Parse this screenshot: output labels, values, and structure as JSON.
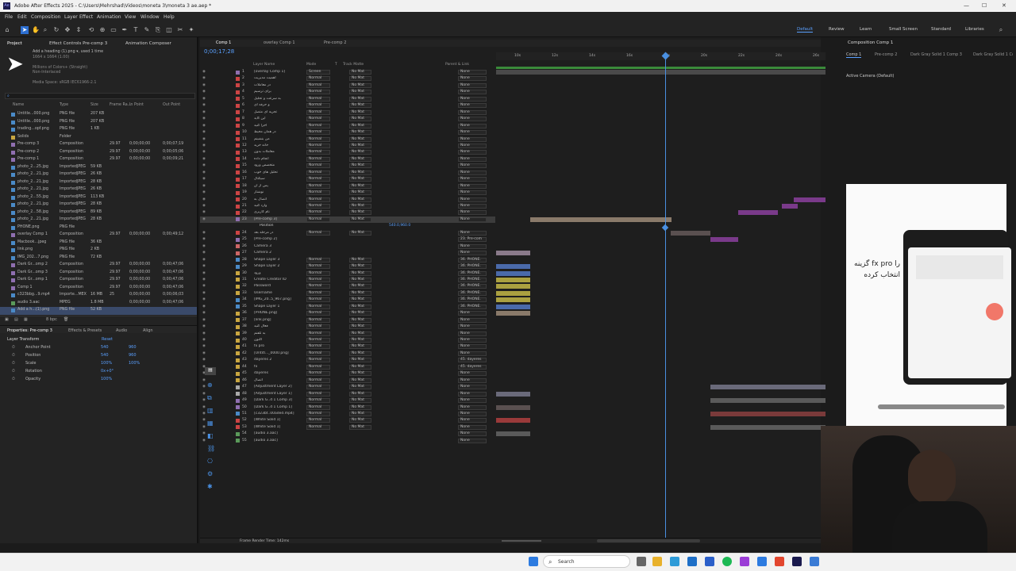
{
  "window": {
    "title": "Adobe After Effects 2025 - C:\\Users\\Mehrshad\\Videos\\moneta 3\\moneta 3 ae.aep *"
  },
  "menu": [
    "File",
    "Edit",
    "Composition",
    "Layer",
    "Effect",
    "Animation",
    "View",
    "Window",
    "Help"
  ],
  "workspaces": [
    "Default",
    "Review",
    "Learn",
    "Small Screen",
    "Standard",
    "Libraries"
  ],
  "project_panel": {
    "tabs": [
      "Project",
      "Effect Controls Pre-comp 3",
      "Animation Composer"
    ],
    "selected_info": [
      "Add a heading (1).png ▾, used 1 time",
      "1664 x 1664 (1.00)",
      "Millions of Colors+ (Straight)",
      "Non-Interlaced",
      "Media Space: sRGB IEC61966-2.1"
    ],
    "columns": [
      "Name",
      "Type",
      "Size",
      "Frame Ra...",
      "In Point",
      "Out Point"
    ],
    "items": [
      {
        "name": "Untitle...000.png",
        "type": "PNG file",
        "size": "207 KB",
        "fr": "",
        "in": "",
        "out": "",
        "color": "#4a8ac7"
      },
      {
        "name": "Untitle...000.png",
        "type": "PNG file",
        "size": "207 KB",
        "fr": "",
        "in": "",
        "out": "",
        "color": "#4a8ac7"
      },
      {
        "name": "trading...opf.png",
        "type": "PNG file",
        "size": "1 KB",
        "fr": "",
        "in": "",
        "out": "",
        "color": "#4a8ac7"
      },
      {
        "name": "Solids",
        "type": "Folder",
        "size": "",
        "fr": "",
        "in": "",
        "out": "",
        "color": "#c9a640"
      },
      {
        "name": "Pre-comp 3",
        "type": "Composition",
        "size": "",
        "fr": "29.97",
        "in": "0;00;00;00",
        "out": "0;00;07;19",
        "color": "#8f6fb0"
      },
      {
        "name": "Pre-comp 2",
        "type": "Composition",
        "size": "",
        "fr": "29.97",
        "in": "0;00;00;00",
        "out": "0;00;05;06",
        "color": "#8f6fb0"
      },
      {
        "name": "Pre-comp 1",
        "type": "Composition",
        "size": "",
        "fr": "29.97",
        "in": "0;00;00;00",
        "out": "0;00;09;21",
        "color": "#8f6fb0"
      },
      {
        "name": "photo_2...25.jpg",
        "type": "ImportedJPEG",
        "size": "59 KB",
        "fr": "",
        "in": "",
        "out": "",
        "color": "#4a8ac7"
      },
      {
        "name": "photo_2...21.jpg",
        "type": "ImportedJPEG",
        "size": "26 KB",
        "fr": "",
        "in": "",
        "out": "",
        "color": "#4a8ac7"
      },
      {
        "name": "photo_2...21.jpg",
        "type": "ImportedJPEG",
        "size": "28 KB",
        "fr": "",
        "in": "",
        "out": "",
        "color": "#4a8ac7"
      },
      {
        "name": "photo_2...21.jpg",
        "type": "ImportedJPEG",
        "size": "26 KB",
        "fr": "",
        "in": "",
        "out": "",
        "color": "#4a8ac7"
      },
      {
        "name": "photo_2...55.jpg",
        "type": "ImportedJPEG",
        "size": "113 KB",
        "fr": "",
        "in": "",
        "out": "",
        "color": "#4a8ac7"
      },
      {
        "name": "photo_2...21.jpg",
        "type": "ImportedJPEG",
        "size": "28 KB",
        "fr": "",
        "in": "",
        "out": "",
        "color": "#4a8ac7"
      },
      {
        "name": "photo_2...58.jpg",
        "type": "ImportedJPEG",
        "size": "89 KB",
        "fr": "",
        "in": "",
        "out": "",
        "color": "#4a8ac7"
      },
      {
        "name": "photo_2...21.jpg",
        "type": "ImportedJPEG",
        "size": "28 KB",
        "fr": "",
        "in": "",
        "out": "",
        "color": "#4a8ac7"
      },
      {
        "name": "PHONE.png",
        "type": "PNG file",
        "size": "",
        "fr": "",
        "in": "",
        "out": "",
        "color": "#4a8ac7"
      },
      {
        "name": "overlay Comp 1",
        "type": "Composition",
        "size": "",
        "fr": "29.97",
        "in": "0;00;00;00",
        "out": "0;00;49;12",
        "color": "#8f6fb0"
      },
      {
        "name": "Macbook...jpeg",
        "type": "PNG file",
        "size": "36 KB",
        "fr": "",
        "in": "",
        "out": "",
        "color": "#4a8ac7"
      },
      {
        "name": "link.png",
        "type": "PNG file",
        "size": "2 KB",
        "fr": "",
        "in": "",
        "out": "",
        "color": "#4a8ac7"
      },
      {
        "name": "IMG_202...7.png",
        "type": "PNG file",
        "size": "72 KB",
        "fr": "",
        "in": "",
        "out": "",
        "color": "#4a8ac7"
      },
      {
        "name": "Dark Gr...omp 2",
        "type": "Composition",
        "size": "",
        "fr": "29.97",
        "in": "0;00;00;00",
        "out": "0;00;47;06",
        "color": "#8f6fb0"
      },
      {
        "name": "Dark Gr...omp 3",
        "type": "Composition",
        "size": "",
        "fr": "29.97",
        "in": "0;00;00;00",
        "out": "0;00;47;06",
        "color": "#8f6fb0"
      },
      {
        "name": "Dark Gr...omp 1",
        "type": "Composition",
        "size": "",
        "fr": "29.97",
        "in": "0;00;00;00",
        "out": "0;00;47;06",
        "color": "#8f6fb0"
      },
      {
        "name": "Comp 1",
        "type": "Composition",
        "size": "",
        "fr": "29.97",
        "in": "0;00;00;00",
        "out": "0;00;47;06",
        "color": "#8f6fb0"
      },
      {
        "name": "c323bbg...9.mp4",
        "type": "Importe...MEX",
        "size": "16 MB",
        "fr": "25",
        "in": "0;00;00;00",
        "out": "0;00;06;03",
        "color": "#4a8ac7"
      },
      {
        "name": "audio 3.aac",
        "type": "MPEG",
        "size": "1.8 MB",
        "fr": "",
        "in": "0;00;00;00",
        "out": "0;00;47;06",
        "color": "#5a9a5a"
      },
      {
        "name": "Add a h...(1).png",
        "type": "PNG file",
        "size": "52 KB",
        "fr": "",
        "in": "",
        "out": "",
        "color": "#4a8ac7"
      }
    ],
    "bpc": "8 bpc"
  },
  "properties_panel": {
    "tabs": [
      "Properties: Pre-comp 3",
      "Effects & Presets",
      "Audio",
      "Align"
    ],
    "section": "Layer Transform",
    "reset": "Reset",
    "props": [
      {
        "label": "Anchor Point",
        "v1": "540",
        "v2": "960"
      },
      {
        "label": "Position",
        "v1": "540",
        "v2": "960"
      },
      {
        "label": "Scale",
        "v1": "100%",
        "v2": "100%"
      },
      {
        "label": "Rotation",
        "v1": "0x+0°",
        "v2": ""
      },
      {
        "label": "Opacity",
        "v1": "100%",
        "v2": ""
      }
    ]
  },
  "timeline": {
    "tabs": [
      "Comp 1",
      "overlay Comp 1",
      "Pre-comp 2"
    ],
    "timecode": "0;00;17;28",
    "headers": [
      "Layer Name",
      "Mode",
      "T",
      "Track Matte",
      "Parent & Link"
    ],
    "ruler": [
      "10s",
      "12s",
      "14s",
      "16s",
      "18s",
      "20s",
      "22s",
      "24s",
      "26s"
    ],
    "position_value": "540.0,960.0",
    "frame_render": "Frame Render Time: 142ms",
    "layers": [
      {
        "num": "1",
        "name": "[overlay Comp 1]",
        "mode": "Screen",
        "matte": "No Mat",
        "parent": "None",
        "color": "#8f6fb0"
      },
      {
        "num": "2",
        "name": "اهمیت مدیریت",
        "mode": "Normal",
        "matte": "No Mat",
        "parent": "None",
        "color": "#c44"
      },
      {
        "num": "3",
        "name": "در معاملات",
        "mode": "Normal",
        "matte": "No Mat",
        "parent": "None",
        "color": "#c44"
      },
      {
        "num": "4",
        "name": "برای ترسیم",
        "mode": "Normal",
        "matte": "No Mat",
        "parent": "None",
        "color": "#c44"
      },
      {
        "num": "5",
        "name": "به سرعت و تحلیل",
        "mode": "Normal",
        "matte": "No Mat",
        "parent": "None",
        "color": "#c44"
      },
      {
        "num": "6",
        "name": "و حرفه ای",
        "mode": "Normal",
        "matte": "No Mat",
        "parent": "None",
        "color": "#c44"
      },
      {
        "num": "7",
        "name": "تجزیه ای متصل",
        "mode": "Normal",
        "matte": "No Mat",
        "parent": "None",
        "color": "#c44"
      },
      {
        "num": "8",
        "name": "اپن گاید",
        "mode": "Normal",
        "matte": "No Mat",
        "parent": "None",
        "color": "#c44"
      },
      {
        "num": "9",
        "name": "اجرا کنید",
        "mode": "Normal",
        "matte": "No Mat",
        "parent": "None",
        "color": "#c44"
      },
      {
        "num": "10",
        "name": "در همان محیط",
        "mode": "Normal",
        "matte": "No Mat",
        "parent": "None",
        "color": "#c44"
      },
      {
        "num": "11",
        "name": "من بنشینم",
        "mode": "Normal",
        "matte": "No Mat",
        "parent": "None",
        "color": "#c44"
      },
      {
        "num": "12",
        "name": "خانه خرید",
        "mode": "Normal",
        "matte": "No Mat",
        "parent": "None",
        "color": "#c44"
      },
      {
        "num": "13",
        "name": "معاملات بدون",
        "mode": "Normal",
        "matte": "No Mat",
        "parent": "None",
        "color": "#c44"
      },
      {
        "num": "14",
        "name": "انجام داده",
        "mode": "Normal",
        "matte": "No Mat",
        "parent": "None",
        "color": "#c44"
      },
      {
        "num": "15",
        "name": "متخصص ورود",
        "mode": "Normal",
        "matte": "No Mat",
        "parent": "None",
        "color": "#c44"
      },
      {
        "num": "16",
        "name": "تحلیل های خوب",
        "mode": "Normal",
        "matte": "No Mat",
        "parent": "None",
        "color": "#c44"
      },
      {
        "num": "17",
        "name": "سیگنال",
        "mode": "Normal",
        "matte": "No Mat",
        "parent": "None",
        "color": "#c44"
      },
      {
        "num": "18",
        "name": "پس از آن",
        "mode": "Normal",
        "matte": "No Mat",
        "parent": "None",
        "color": "#c44"
      },
      {
        "num": "19",
        "name": "نوشتار",
        "mode": "Normal",
        "matte": "No Mat",
        "parent": "None",
        "color": "#c44"
      },
      {
        "num": "20",
        "name": "اتصال به",
        "mode": "Normal",
        "matte": "No Mat",
        "parent": "None",
        "color": "#c44"
      },
      {
        "num": "21",
        "name": "وارد کنید",
        "mode": "Normal",
        "matte": "No Mat",
        "parent": "None",
        "color": "#c44"
      },
      {
        "num": "22",
        "name": "نام کاربری",
        "mode": "Normal",
        "matte": "No Mat",
        "parent": "None",
        "color": "#c44"
      },
      {
        "num": "23",
        "name": "[Pre-comp 3]",
        "mode": "Normal",
        "matte": "No Mat",
        "parent": "None",
        "color": "#8f6fb0",
        "selected": true
      },
      {
        "num": "",
        "name": "Position",
        "mode": "",
        "matte": "",
        "parent": "",
        "color": "",
        "sub": true
      },
      {
        "num": "24",
        "name": "در مرحله بعد",
        "mode": "Normal",
        "matte": "No Mat",
        "parent": "None",
        "color": "#c44"
      },
      {
        "num": "25",
        "name": "[Pre-comp 2]",
        "mode": "",
        "matte": "",
        "parent": "23. Pre-com",
        "color": "#8f6fb0"
      },
      {
        "num": "26",
        "name": "Camera 3",
        "mode": "",
        "matte": "",
        "parent": "None",
        "color": "#c66"
      },
      {
        "num": "27",
        "name": "Camera 2",
        "mode": "",
        "matte": "",
        "parent": "None",
        "color": "#c66"
      },
      {
        "num": "28",
        "name": "Shape Layer 3",
        "mode": "Normal",
        "matte": "No Mat",
        "parent": "36. PHONE.",
        "color": "#4a8ac7"
      },
      {
        "num": "29",
        "name": "Shape Layer 2",
        "mode": "Normal",
        "matte": "No Mat",
        "parent": "36. PHONE.",
        "color": "#4a8ac7"
      },
      {
        "num": "30",
        "name": "ورود",
        "mode": "Normal",
        "matte": "No Mat",
        "parent": "36. PHONE.",
        "color": "#c9a640"
      },
      {
        "num": "31",
        "name": "Create Creditor ID",
        "mode": "Normal",
        "matte": "No Mat",
        "parent": "36. PHONE.",
        "color": "#c9a640"
      },
      {
        "num": "32",
        "name": "Password",
        "mode": "Normal",
        "matte": "No Mat",
        "parent": "36. PHONE.",
        "color": "#c9a640"
      },
      {
        "num": "33",
        "name": "Username",
        "mode": "Normal",
        "matte": "No Mat",
        "parent": "36. PHONE.",
        "color": "#c9a640"
      },
      {
        "num": "34",
        "name": "[IMG_20..5_967.png]",
        "mode": "Normal",
        "matte": "No Mat",
        "parent": "36. PHONE.",
        "color": "#4a8ac7"
      },
      {
        "num": "35",
        "name": "Shape Layer 1",
        "mode": "Normal",
        "matte": "No Mat",
        "parent": "36. PHONE.",
        "color": "#4a8ac7"
      },
      {
        "num": "36",
        "name": "[PHONE.png]",
        "mode": "Normal",
        "matte": "No Mat",
        "parent": "None",
        "color": "#c9a640"
      },
      {
        "num": "37",
        "name": "[link.png]",
        "mode": "Normal",
        "matte": "No Mat",
        "parent": "None",
        "color": "#c9a640"
      },
      {
        "num": "38",
        "name": "فعال کنید",
        "mode": "Normal",
        "matte": "No Mat",
        "parent": "None",
        "color": "#c9a640"
      },
      {
        "num": "39",
        "name": "به تلفنم",
        "mode": "Normal",
        "matte": "No Mat",
        "parent": "None",
        "color": "#c9a640"
      },
      {
        "num": "40",
        "name": "اکنون",
        "mode": "Normal",
        "matte": "No Mat",
        "parent": "None",
        "color": "#c9a640"
      },
      {
        "num": "41",
        "name": "fx pro",
        "mode": "Normal",
        "matte": "No Mat",
        "parent": "None",
        "color": "#c9a640"
      },
      {
        "num": "42",
        "name": "[Untitl..._0000.png]",
        "mode": "Normal",
        "matte": "No Mat",
        "parent": "None",
        "color": "#c9a640"
      },
      {
        "num": "43",
        "name": "dayeres 2",
        "mode": "Normal",
        "matte": "No Mat",
        "parent": "45. dayeres",
        "color": "#c9a640"
      },
      {
        "num": "44",
        "name": "fx",
        "mode": "Normal",
        "matte": "No Mat",
        "parent": "45. dayeres",
        "color": "#c9a640"
      },
      {
        "num": "45",
        "name": "dayeres",
        "mode": "Normal",
        "matte": "No Mat",
        "parent": "None",
        "color": "#c9a640"
      },
      {
        "num": "46",
        "name": "اتصال",
        "mode": "Normal",
        "matte": "No Mat",
        "parent": "None",
        "color": "#c9a640"
      },
      {
        "num": "47",
        "name": "[Adjustment Layer 2]",
        "mode": "Normal",
        "matte": "No Mat",
        "parent": "None",
        "color": "#aaa"
      },
      {
        "num": "48",
        "name": "[Adjustment Layer 1]",
        "mode": "Normal",
        "matte": "No Mat",
        "parent": "None",
        "color": "#aaa"
      },
      {
        "num": "49",
        "name": "[Dark G..d 1 Comp 3]",
        "mode": "Normal",
        "matte": "No Mat",
        "parent": "None",
        "color": "#8f6fb0"
      },
      {
        "num": "50",
        "name": "[Dark G..d 1 Comp 1]",
        "mode": "Normal",
        "matte": "No Mat",
        "parent": "None",
        "color": "#8f6fb0"
      },
      {
        "num": "51",
        "name": "[c323bt..00aded.mp4]",
        "mode": "Normal",
        "matte": "No Mat",
        "parent": "None",
        "color": "#4a8ac7"
      },
      {
        "num": "52",
        "name": "[White Solid 1]",
        "mode": "Normal",
        "matte": "No Mat",
        "parent": "None",
        "color": "#c44"
      },
      {
        "num": "53",
        "name": "[White Solid 1]",
        "mode": "Normal",
        "matte": "No Mat",
        "parent": "None",
        "color": "#c44"
      },
      {
        "num": "54",
        "name": "[audio 3.aac]",
        "mode": "",
        "matte": "",
        "parent": "None",
        "color": "#5a9a5a"
      },
      {
        "num": "55",
        "name": "[audio 3.aac]",
        "mode": "",
        "matte": "",
        "parent": "None",
        "color": "#5a9a5a"
      }
    ]
  },
  "composition_panel": {
    "title": "Composition Comp 1",
    "tabs": [
      "Comp 1",
      "Pre-comp 2",
      "Dark Gray Solid 1 Comp 3",
      "Dark Gray Solid 1 Comp"
    ],
    "camera": "Active Camera (Default)",
    "preview_text_1": "گزینه fx pro را",
    "preview_text_2": "انتخاب کرده"
  },
  "taskbar": {
    "search": "Search"
  }
}
